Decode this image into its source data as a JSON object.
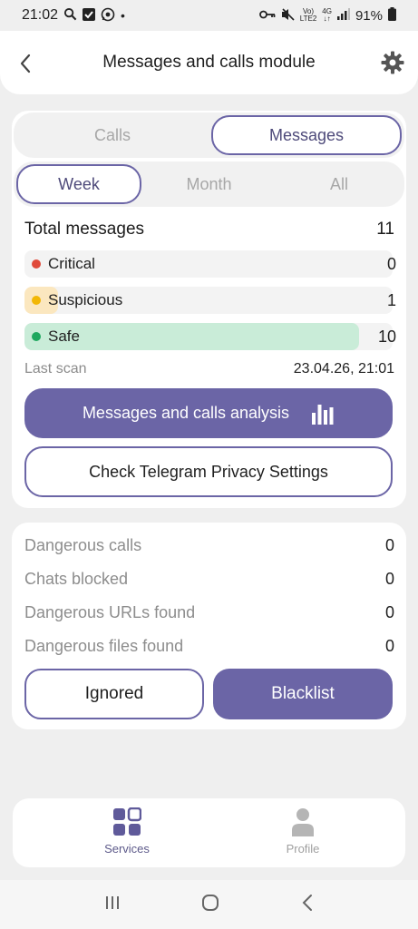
{
  "status_bar": {
    "time": "21:02",
    "battery": "91%",
    "network_top": "Vo)",
    "network_bottom": "LTE2",
    "gen_top": "4G",
    "gen_bottom": "↓↑"
  },
  "header": {
    "title": "Messages and calls module"
  },
  "tabs_type": [
    "Calls",
    "Messages"
  ],
  "tabs_type_selected": "Messages",
  "tabs_period": [
    "Week",
    "Month",
    "All"
  ],
  "tabs_period_selected": "Week",
  "stats": {
    "total_label": "Total messages",
    "total_value": "11",
    "critical": {
      "label": "Critical",
      "value": "0",
      "color": "#e04a3a",
      "fraction": 0.0
    },
    "suspicious": {
      "label": "Suspicious",
      "value": "1",
      "color": "#f2b705",
      "fraction": 0.09
    },
    "safe": {
      "label": "Safe",
      "value": "10",
      "color": "#1fa85f",
      "fraction": 0.91
    },
    "last_scan_label": "Last scan",
    "last_scan_value": "23.04.26, 21:01"
  },
  "actions": {
    "analysis_label": "Messages and calls analysis",
    "telegram_label": "Check Telegram Privacy Settings"
  },
  "danger": {
    "rows": [
      {
        "label": "Dangerous calls",
        "value": "0"
      },
      {
        "label": "Chats blocked",
        "value": "0"
      },
      {
        "label": "Dangerous URLs found",
        "value": "0"
      },
      {
        "label": "Dangerous files found",
        "value": "0"
      }
    ],
    "ignored_label": "Ignored",
    "blacklist_label": "Blacklist"
  },
  "bottom_nav": {
    "services": "Services",
    "profile": "Profile"
  },
  "colors": {
    "accent": "#6b65a6",
    "safe_fill": "#c9ecd8",
    "suspicious_fill": "#fbe7bf"
  }
}
